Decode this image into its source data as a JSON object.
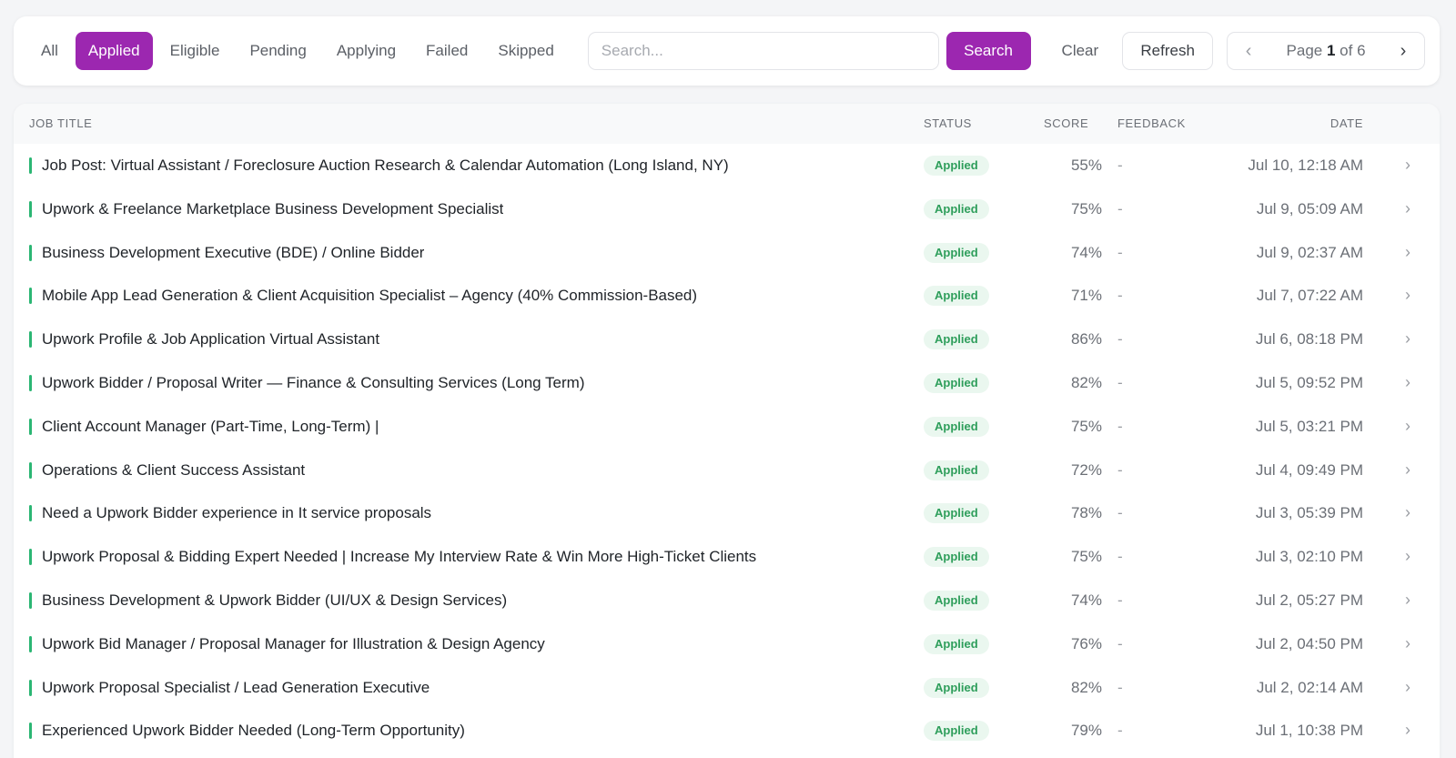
{
  "filters": {
    "tabs": [
      {
        "label": "All",
        "active": false
      },
      {
        "label": "Applied",
        "active": true
      },
      {
        "label": "Eligible",
        "active": false
      },
      {
        "label": "Pending",
        "active": false
      },
      {
        "label": "Applying",
        "active": false
      },
      {
        "label": "Failed",
        "active": false
      },
      {
        "label": "Skipped",
        "active": false
      }
    ],
    "search_placeholder": "Search...",
    "search_value": "",
    "search_label": "Search",
    "clear_label": "Clear",
    "refresh_label": "Refresh"
  },
  "pagination": {
    "prefix": "Page",
    "current": "1",
    "of_label": "of",
    "total": "6",
    "prev_icon": "chevron-left-icon",
    "next_icon": "chevron-right-icon"
  },
  "table": {
    "headers": {
      "title": "Job Title",
      "status": "Status",
      "score": "Score",
      "feedback": "Feedback",
      "date": "Date"
    },
    "rows": [
      {
        "title": "Job Post: Virtual Assistant / Foreclosure Auction Research & Calendar Automation (Long Island, NY)",
        "status": "Applied",
        "score": "55%",
        "feedback": "-",
        "date": "Jul 10, 12:18 AM"
      },
      {
        "title": "Upwork & Freelance Marketplace Business Development Specialist",
        "status": "Applied",
        "score": "75%",
        "feedback": "-",
        "date": "Jul 9, 05:09 AM"
      },
      {
        "title": "Business Development Executive (BDE) / Online Bidder",
        "status": "Applied",
        "score": "74%",
        "feedback": "-",
        "date": "Jul 9, 02:37 AM"
      },
      {
        "title": "Mobile App Lead Generation & Client Acquisition Specialist – Agency (40% Commission-Based)",
        "status": "Applied",
        "score": "71%",
        "feedback": "-",
        "date": "Jul 7, 07:22 AM"
      },
      {
        "title": "Upwork Profile & Job Application Virtual Assistant",
        "status": "Applied",
        "score": "86%",
        "feedback": "-",
        "date": "Jul 6, 08:18 PM"
      },
      {
        "title": "Upwork Bidder / Proposal Writer — Finance & Consulting Services (Long Term)",
        "status": "Applied",
        "score": "82%",
        "feedback": "-",
        "date": "Jul 5, 09:52 PM"
      },
      {
        "title": "Client Account Manager (Part-Time, Long-Term) |",
        "status": "Applied",
        "score": "75%",
        "feedback": "-",
        "date": "Jul 5, 03:21 PM"
      },
      {
        "title": "Operations & Client Success Assistant",
        "status": "Applied",
        "score": "72%",
        "feedback": "-",
        "date": "Jul 4, 09:49 PM"
      },
      {
        "title": "Need a Upwork Bidder experience in It service proposals",
        "status": "Applied",
        "score": "78%",
        "feedback": "-",
        "date": "Jul 3, 05:39 PM"
      },
      {
        "title": "Upwork Proposal & Bidding Expert Needed | Increase My Interview Rate & Win More High-Ticket Clients",
        "status": "Applied",
        "score": "75%",
        "feedback": "-",
        "date": "Jul 3, 02:10 PM"
      },
      {
        "title": "Business Development & Upwork Bidder (UI/UX & Design Services)",
        "status": "Applied",
        "score": "74%",
        "feedback": "-",
        "date": "Jul 2, 05:27 PM"
      },
      {
        "title": "Upwork Bid Manager / Proposal Manager for Illustration & Design Agency",
        "status": "Applied",
        "score": "76%",
        "feedback": "-",
        "date": "Jul 2, 04:50 PM"
      },
      {
        "title": "Upwork Proposal Specialist / Lead Generation Executive",
        "status": "Applied",
        "score": "82%",
        "feedback": "-",
        "date": "Jul 2, 02:14 AM"
      },
      {
        "title": "Experienced Upwork Bidder Needed (Long-Term Opportunity)",
        "status": "Applied",
        "score": "79%",
        "feedback": "-",
        "date": "Jul 1, 10:38 PM"
      }
    ]
  },
  "colors": {
    "accent": "#9c27b0",
    "status_applied_text": "#2e9e5b",
    "status_applied_bg": "#eaf7ef",
    "row_indicator": "#2bb673"
  }
}
